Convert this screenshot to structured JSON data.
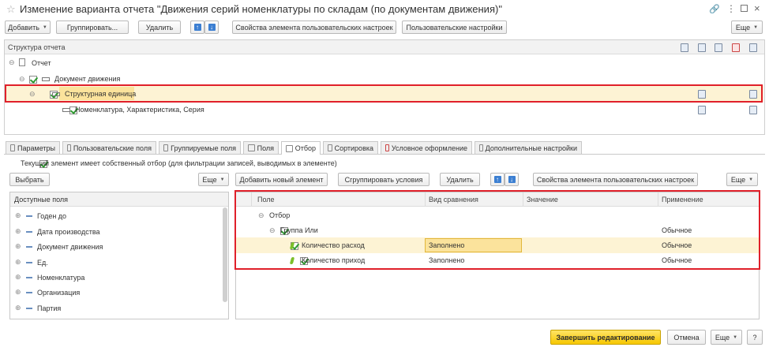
{
  "window": {
    "title": "Изменение варианта отчета \"Движения серий номенклатуры по складам (по документам движения)\""
  },
  "toolbar": {
    "add": "Добавить",
    "group": "Группировать...",
    "delete": "Удалить",
    "element_props": "Свойства элемента пользовательских настроек",
    "user_settings": "Пользовательские настройки",
    "more": "Еще"
  },
  "structure": {
    "header": "Структура отчета",
    "rows": [
      {
        "label": "Отчет"
      },
      {
        "label": "Документ движения"
      },
      {
        "label": "Структурная единица"
      },
      {
        "label": "Номенклатура, Характеристика, Серия"
      }
    ]
  },
  "tabs": [
    {
      "label": "Параметры"
    },
    {
      "label": "Пользовательские поля"
    },
    {
      "label": "Группируемые поля"
    },
    {
      "label": "Поля"
    },
    {
      "label": "Отбор"
    },
    {
      "label": "Сортировка"
    },
    {
      "label": "Условное оформление"
    },
    {
      "label": "Дополнительные настройки"
    }
  ],
  "filter": {
    "own_filter_label": "Текущий элемент имеет собственный отбор (для фильтрации записей, выводимых в элементе)",
    "select_btn": "Выбрать",
    "more_left": "Еще",
    "add_new": "Добавить новый элемент",
    "group_conditions": "Сгруппировать условия",
    "delete": "Удалить",
    "element_props": "Свойства элемента пользовательских настроек",
    "more_right": "Еще",
    "available_fields_header": "Доступные поля",
    "available_fields": [
      "Годен до",
      "Дата производства",
      "Документ движения",
      "Ед.",
      "Номенклатура",
      "Организация",
      "Партия"
    ],
    "columns": {
      "field": "Поле",
      "comparison": "Вид сравнения",
      "value": "Значение",
      "application": "Применение"
    },
    "rows": [
      {
        "field": "Отбор",
        "comparison": "",
        "value": "",
        "application": ""
      },
      {
        "field": "Группа Или",
        "comparison": "",
        "value": "",
        "application": "Обычное"
      },
      {
        "field": "Количество расход",
        "comparison": "Заполнено",
        "value": "",
        "application": "Обычное"
      },
      {
        "field": "Количество приход",
        "comparison": "Заполнено",
        "value": "",
        "application": "Обычное"
      }
    ]
  },
  "footer": {
    "finish": "Завершить редактирование",
    "cancel": "Отмена",
    "more": "Еще",
    "help": "?"
  },
  "colors": {
    "highlight_red": "#e0202a",
    "selected_row": "#fdf0c4",
    "primary_yellow": "#f6c700"
  }
}
